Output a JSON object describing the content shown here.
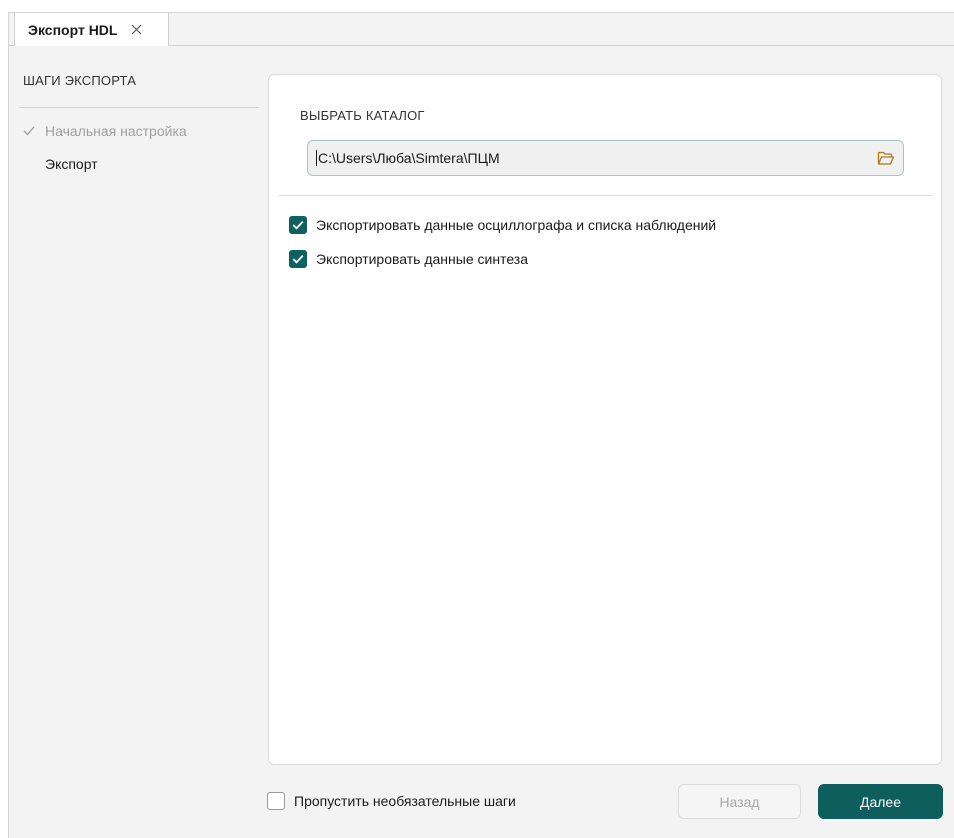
{
  "tab": {
    "title": "Экспорт HDL",
    "close_icon": "close-icon"
  },
  "sidebar": {
    "title": "ШАГИ ЭКСПОРТА",
    "steps": [
      {
        "label": "Начальная настройка",
        "state": "done"
      },
      {
        "label": "Экспорт",
        "state": "current"
      }
    ]
  },
  "main": {
    "section_label": "ВЫБРАТЬ КАТАЛОГ",
    "path_value": "C:\\Users\\Люба\\Simtera\\ПЦМ",
    "folder_icon": "folder-open-icon",
    "options": [
      {
        "label": "Экспортировать данные осциллографа и списка наблюдений",
        "checked": true
      },
      {
        "label": "Экспортировать данные синтеза",
        "checked": true
      }
    ]
  },
  "footer": {
    "skip_label": "Пропустить необязательные шаги",
    "skip_checked": false,
    "back_label": "Назад",
    "next_label": "Далее"
  },
  "colors": {
    "accent": "#0f5e5e",
    "disabled_text": "#a8a8a8",
    "muted_text": "#a0a0a0"
  }
}
